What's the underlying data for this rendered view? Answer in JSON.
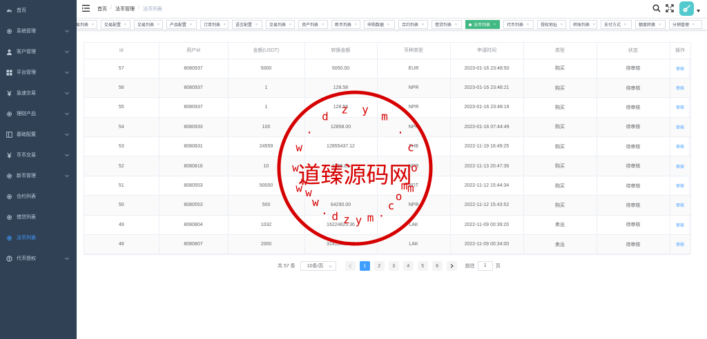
{
  "sidebar": {
    "items": [
      {
        "label": "首页",
        "icon": "dashboard-icon",
        "has_children": false
      },
      {
        "label": "系统管理",
        "icon": "gear-icon",
        "has_children": true
      },
      {
        "label": "客户管理",
        "icon": "user-icon",
        "has_children": true
      },
      {
        "label": "平台管理",
        "icon": "grid-icon",
        "has_children": true
      },
      {
        "label": "急速交易",
        "icon": "yen-icon",
        "has_children": true
      },
      {
        "label": "理财产品",
        "icon": "gear-icon",
        "has_children": true
      },
      {
        "label": "基础配置",
        "icon": "panel-icon",
        "has_children": true
      },
      {
        "label": "币币交易",
        "icon": "yen-icon",
        "has_children": true
      },
      {
        "label": "新币管理",
        "icon": "gear-icon",
        "has_children": true
      },
      {
        "label": "合约列表",
        "icon": "gear-icon",
        "has_children": false
      },
      {
        "label": "借贷列表",
        "icon": "gear-icon",
        "has_children": false
      },
      {
        "label": "法币列表",
        "icon": "gear-icon",
        "has_children": false,
        "active": true
      },
      {
        "label": "代币授权",
        "icon": "coin-icon",
        "has_children": true
      }
    ]
  },
  "header": {
    "breadcrumb": [
      "首页",
      "法币管理",
      "法币列表"
    ]
  },
  "tags": [
    {
      "label": "易列表"
    },
    {
      "label": "交易配置"
    },
    {
      "label": "交易列表"
    },
    {
      "label": "产品配置"
    },
    {
      "label": "订单列表"
    },
    {
      "label": "语言配置"
    },
    {
      "label": "交易列表"
    },
    {
      "label": "资产列表"
    },
    {
      "label": "新币列表"
    },
    {
      "label": "申购数据"
    },
    {
      "label": "合约列表"
    },
    {
      "label": "借贷列表"
    },
    {
      "label": "法币列表",
      "active": true
    },
    {
      "label": "代币列表"
    },
    {
      "label": "授权地址"
    },
    {
      "label": "转账列表"
    },
    {
      "label": "支付方式"
    },
    {
      "label": "额度转换"
    },
    {
      "label": "分销管理"
    }
  ],
  "table": {
    "columns": [
      "Id",
      "用户Id",
      "金额(USDT)",
      "转换金额",
      "币种类型",
      "申请时间",
      "类型",
      "状态",
      "操作"
    ],
    "rows": [
      [
        "57",
        "8080937",
        "5000",
        "5050.00",
        "EUR",
        "2023-01-16 23:48:50",
        "购买",
        "待审核",
        "审核"
      ],
      [
        "56",
        "8080937",
        "1",
        "128.58",
        "NPR",
        "2023-01-16 23:48:21",
        "购买",
        "待审核",
        "审核"
      ],
      [
        "55",
        "8080937",
        "1",
        "128.58",
        "NPR",
        "2023-01-16 23:48:19",
        "购买",
        "待审核",
        "审核"
      ],
      [
        "54",
        "8080933",
        "100",
        "12858.00",
        "NPR",
        "2023-01-16 07:44:49",
        "购买",
        "待审核",
        "审核"
      ],
      [
        "53",
        "8080831",
        "24559",
        "12855437.12",
        "THB",
        "2022-11-19 16:49:25",
        "购买",
        "待审核",
        "审核"
      ],
      [
        "52",
        "8080816",
        "10",
        "1285.81",
        "NPR",
        "2022-11-13 20:47:36",
        "购买",
        "待审核",
        "审核"
      ],
      [
        "51",
        "8080553",
        "50000",
        "",
        "BDT",
        "2022-11-12 15:44:34",
        "购买",
        "待审核",
        "审核"
      ],
      [
        "50",
        "8080553",
        "500",
        "64290.00",
        "NPR",
        "2022-11-12 15:43:52",
        "购买",
        "待审核",
        "审核"
      ],
      [
        "49",
        "8080804",
        "1032",
        "16224825.36",
        "LAK",
        "2022-11-09 00:39:20",
        "卖出",
        "待审核",
        "审核"
      ],
      [
        "48",
        "8080807",
        "2000",
        "31413460.00",
        "LAK",
        "2022-11-09 00:34:00",
        "卖出",
        "待审核",
        "审核"
      ]
    ]
  },
  "pagination": {
    "total_label": "共 57 条",
    "page_size": "10条/页",
    "pages": [
      "1",
      "2",
      "3",
      "4",
      "5",
      "6"
    ],
    "current": "1",
    "goto_prefix": "前往",
    "goto_value": "1",
    "goto_suffix": "页"
  },
  "watermark": {
    "text": "道臻源码网",
    "url": "www.dzym.com",
    "color": "#d60000"
  }
}
